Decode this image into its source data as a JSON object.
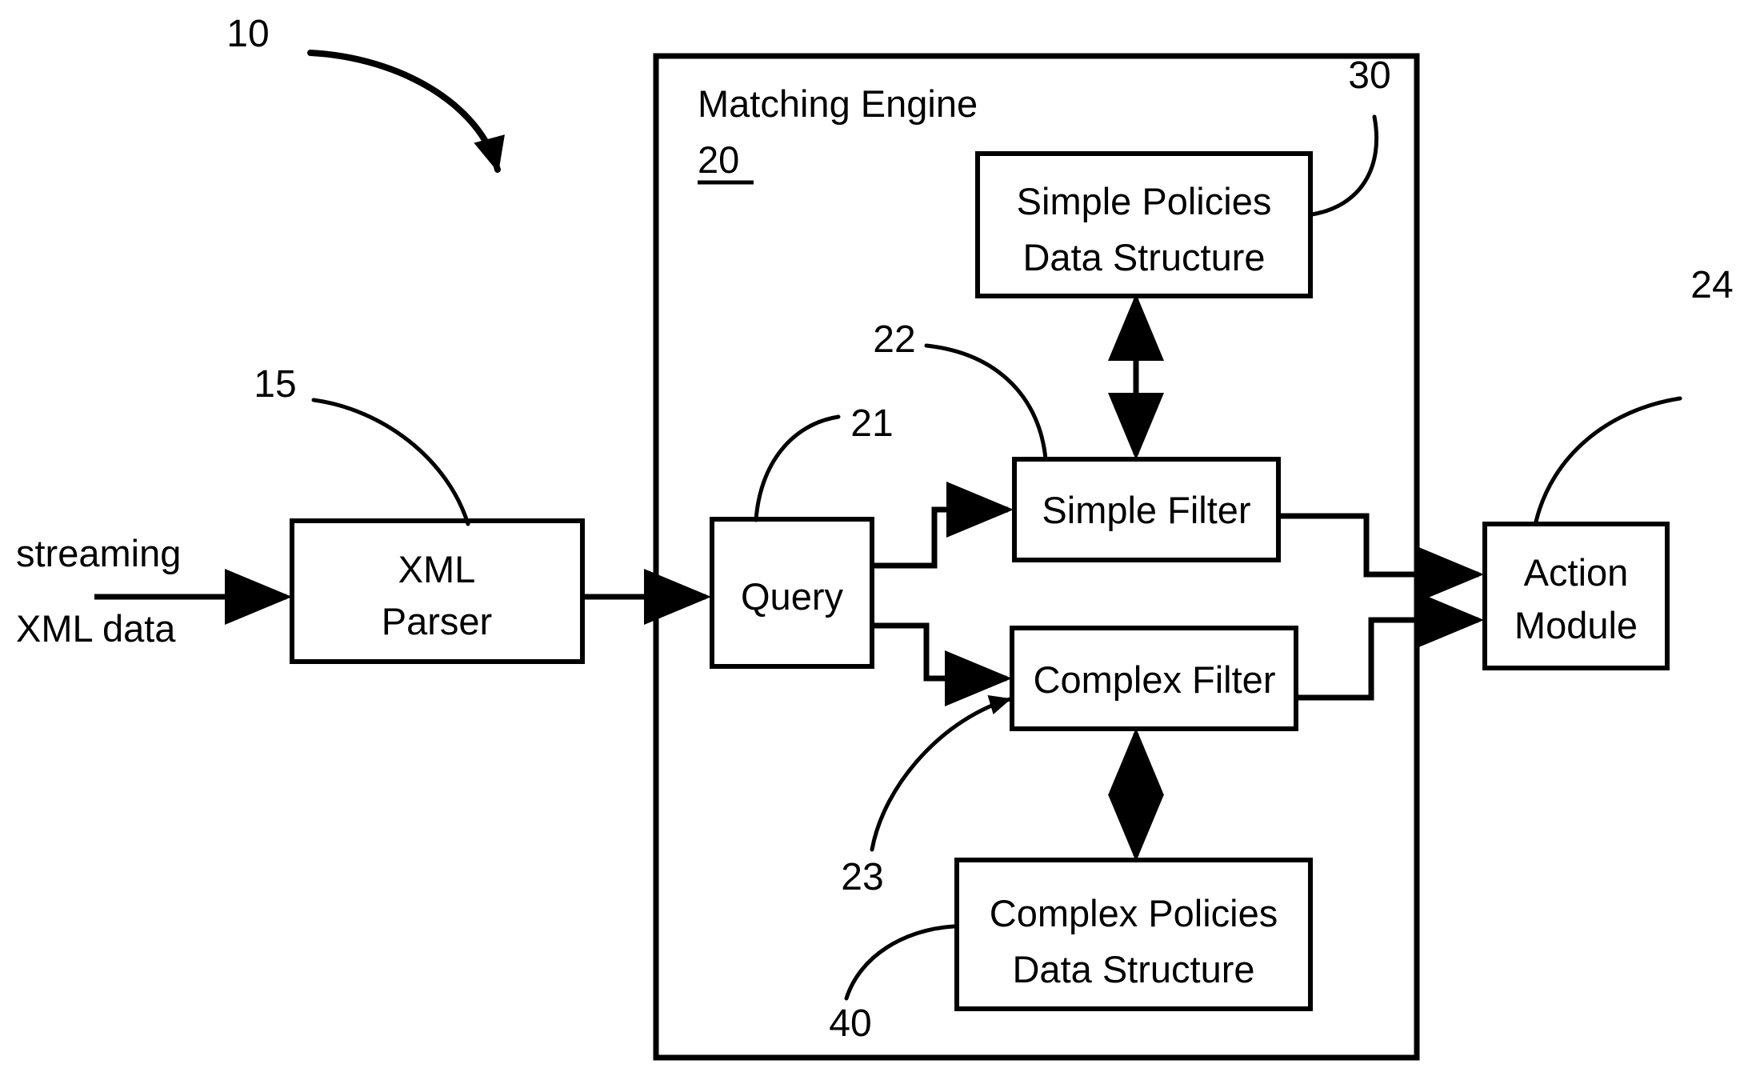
{
  "figure": {
    "title_reference": "10",
    "background_color": "#ffffff",
    "line_color": "#000000"
  },
  "input": {
    "label_line1": "streaming",
    "label_line2": "XML data"
  },
  "boxes": {
    "xml_parser": {
      "line1": "XML",
      "line2": "Parser",
      "reference": "15"
    },
    "matching_engine": {
      "title": "Matching Engine",
      "reference": "20"
    },
    "query": {
      "label": "Query",
      "reference": "21"
    },
    "simple_filter": {
      "label": "Simple Filter",
      "reference": "22"
    },
    "complex_filter": {
      "label": "Complex Filter",
      "reference": "23"
    },
    "simple_policies": {
      "line1": "Simple Policies",
      "line2": "Data Structure",
      "reference": "30"
    },
    "complex_policies": {
      "line1": "Complex Policies",
      "line2": "Data Structure",
      "reference": "40"
    },
    "action_module": {
      "line1": "Action",
      "line2": "Module",
      "reference": "24"
    }
  }
}
